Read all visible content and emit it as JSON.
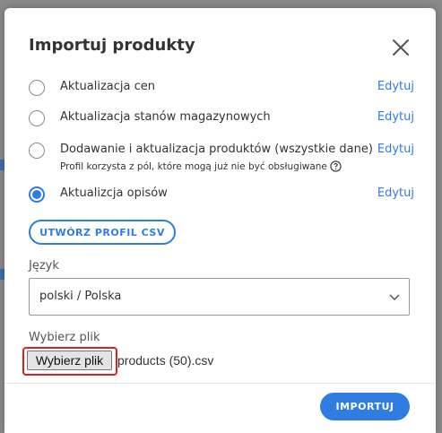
{
  "modal": {
    "title": "Importuj produkty",
    "close_icon": "close-icon"
  },
  "options": [
    {
      "label": "Aktualizacja cen",
      "sublabel": "",
      "edit": "Edytuj",
      "checked": false
    },
    {
      "label": "Aktualizacja stanów magazynowych",
      "sublabel": "",
      "edit": "Edytuj",
      "checked": false
    },
    {
      "label": "Dodawanie i aktualizacja produktów (wszystkie dane)",
      "sublabel": "Profil korzysta z pól, które mogą już nie być obsługiwane",
      "edit": "Edytuj",
      "checked": false
    },
    {
      "label": "Aktualizcja opisów",
      "sublabel": "",
      "edit": "Edytuj",
      "checked": true
    }
  ],
  "csv_profile_button": "UTWÓRZ PROFIL CSV",
  "language": {
    "label": "Język",
    "selected": "polski / Polska"
  },
  "file": {
    "label": "Wybierz plik",
    "button": "Wybierz plik",
    "filename": "products (50).csv"
  },
  "footer": {
    "import_button": "IMPORTUJ"
  },
  "colors": {
    "accent": "#2f7de1",
    "highlight": "#e02020"
  }
}
